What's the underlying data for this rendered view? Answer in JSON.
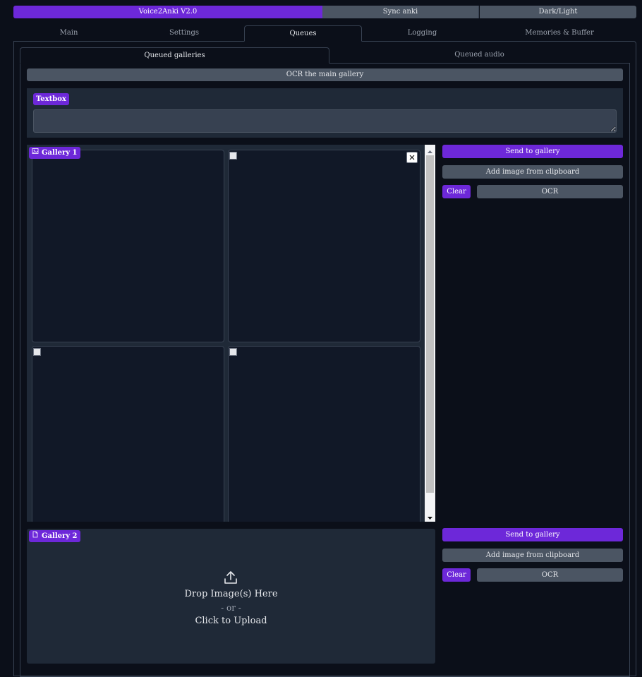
{
  "topbar": {
    "title": "Voice2Anki V2.0",
    "sync": "Sync anki",
    "theme": "Dark/Light"
  },
  "main_tabs": [
    "Main",
    "Settings",
    "Queues",
    "Logging",
    "Memories & Buffer"
  ],
  "sub_tabs": [
    "Queued galleries",
    "Queued audio"
  ],
  "ocr_main": "OCR the main gallery",
  "textbox": {
    "label": "Textbox",
    "value": ""
  },
  "gallery1": {
    "label": "Gallery 1",
    "send": "Send to gallery",
    "add": "Add image from clipboard",
    "clear": "Clear",
    "ocr": "OCR"
  },
  "gallery2": {
    "label": "Gallery 2",
    "drop": "Drop Image(s) Here",
    "or": "- or -",
    "click": "Click to Upload",
    "send": "Send to gallery",
    "add": "Add image from clipboard",
    "clear": "Clear",
    "ocr": "OCR"
  },
  "colors": {
    "accent": "#6d28d9",
    "bg": "#0b0f19",
    "panel": "#1f2937",
    "button_gray": "#4b5563"
  },
  "icons": [
    "image-icon",
    "file-icon",
    "upload-icon",
    "close-icon",
    "scroll-up-icon",
    "scroll-down-icon"
  ]
}
